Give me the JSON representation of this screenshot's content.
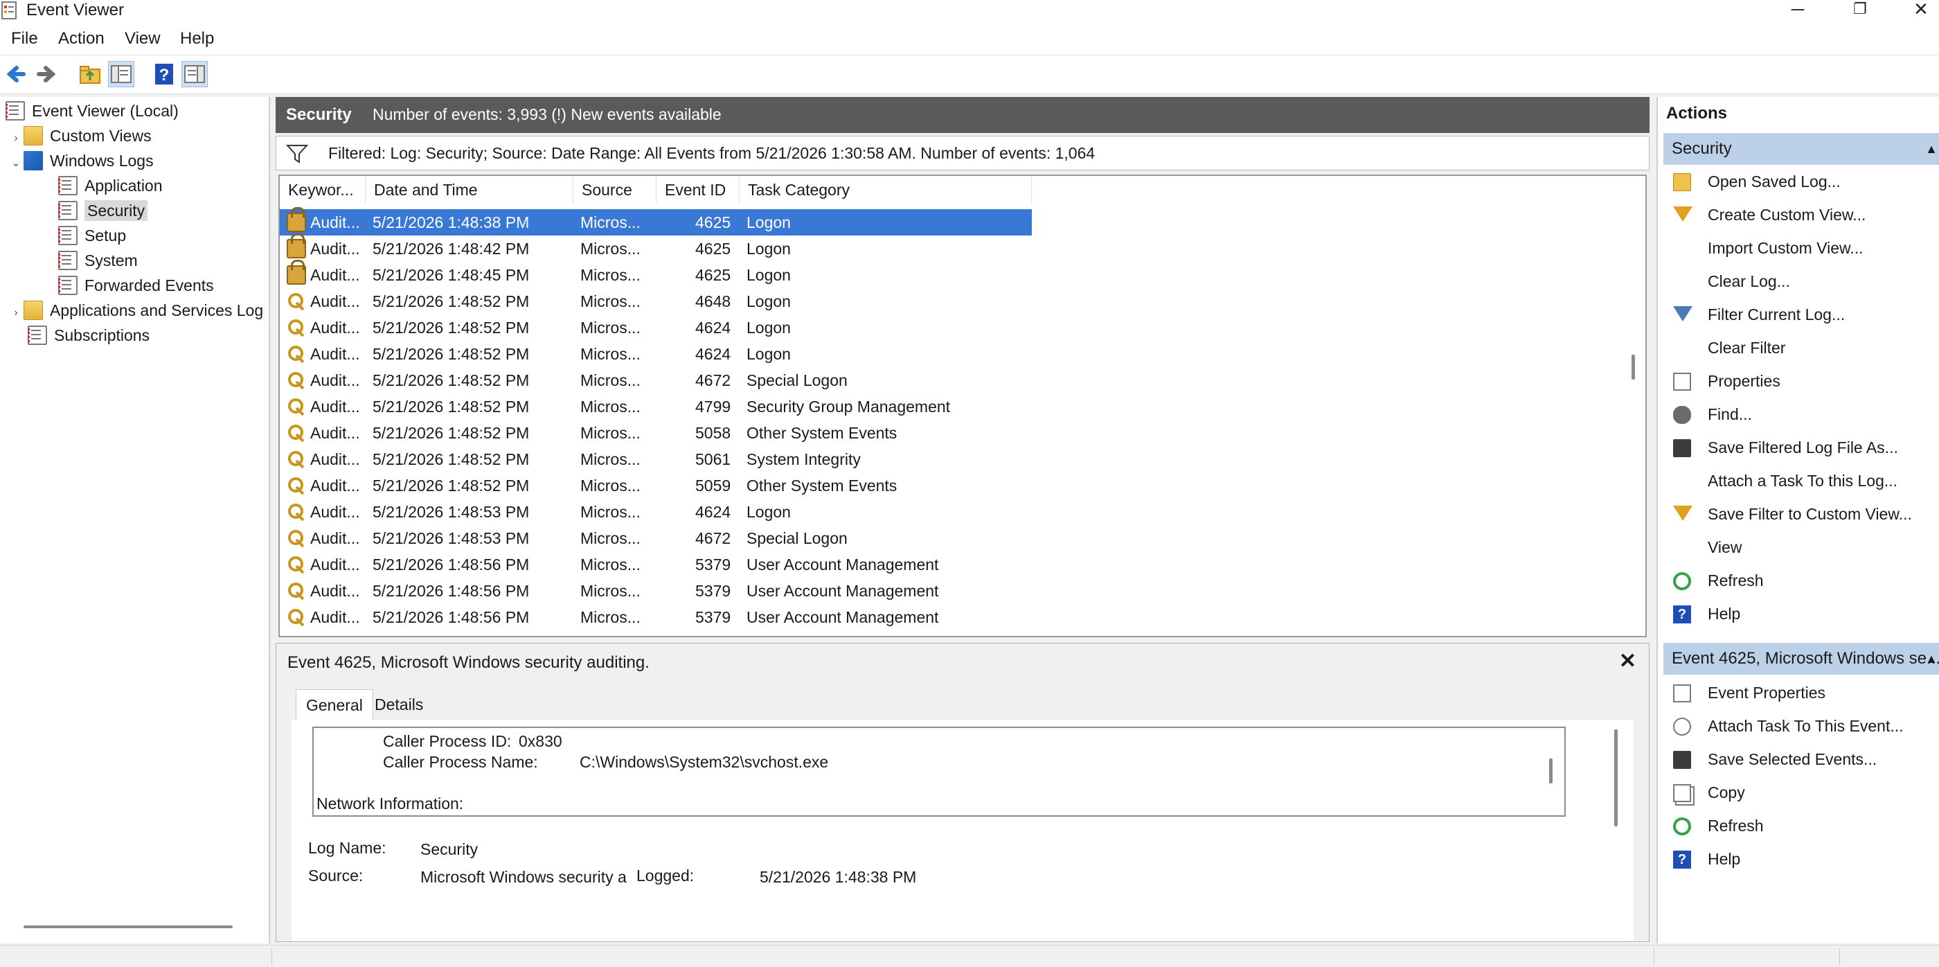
{
  "window": {
    "title": "Event Viewer",
    "minimize": "─",
    "restore": "❐",
    "close": "✕"
  },
  "menu": [
    "File",
    "Action",
    "View",
    "Help"
  ],
  "tree": {
    "items": [
      {
        "label": "Event Viewer (Local)",
        "icon": "event-viewer-icon",
        "expander": ""
      },
      {
        "label": "Custom Views",
        "icon": "folder-icon",
        "expander": "›"
      },
      {
        "label": "Windows Logs",
        "icon": "windows-logs-icon",
        "expander": "⌄"
      },
      {
        "label": "Application",
        "icon": "log-icon",
        "expander": ""
      },
      {
        "label": "Security",
        "icon": "log-icon",
        "expander": ""
      },
      {
        "label": "Setup",
        "icon": "log-icon",
        "expander": ""
      },
      {
        "label": "System",
        "icon": "log-icon",
        "expander": ""
      },
      {
        "label": "Forwarded Events",
        "icon": "log-icon",
        "expander": ""
      },
      {
        "label": "Applications and Services Log",
        "icon": "folder-icon",
        "expander": "›"
      },
      {
        "label": "Subscriptions",
        "icon": "subscriptions-icon",
        "expander": ""
      }
    ],
    "selected": "Security"
  },
  "log_header": {
    "name": "Security",
    "info": "Number of events: 3,993 (!) New events available"
  },
  "filter": {
    "text": "Filtered: Log: Security; Source: Date Range: All Events from 5/21/2026 1:30:58 AM. Number of events: 1,064"
  },
  "grid": {
    "columns": [
      "Keywor...",
      "Date and Time",
      "Source",
      "Event ID",
      "Task Category"
    ],
    "sort_indicator": "^",
    "rows": [
      {
        "icon": "lock",
        "keywords": "Audit...",
        "datetime": "5/21/2026 1:48:38 PM",
        "source": "Micros...",
        "event_id": "4625",
        "task": "Logon"
      },
      {
        "icon": "lock",
        "keywords": "Audit...",
        "datetime": "5/21/2026 1:48:42 PM",
        "source": "Micros...",
        "event_id": "4625",
        "task": "Logon"
      },
      {
        "icon": "lock",
        "keywords": "Audit...",
        "datetime": "5/21/2026 1:48:45 PM",
        "source": "Micros...",
        "event_id": "4625",
        "task": "Logon"
      },
      {
        "icon": "key",
        "keywords": "Audit...",
        "datetime": "5/21/2026 1:48:52 PM",
        "source": "Micros...",
        "event_id": "4648",
        "task": "Logon"
      },
      {
        "icon": "key",
        "keywords": "Audit...",
        "datetime": "5/21/2026 1:48:52 PM",
        "source": "Micros...",
        "event_id": "4624",
        "task": "Logon"
      },
      {
        "icon": "key",
        "keywords": "Audit...",
        "datetime": "5/21/2026 1:48:52 PM",
        "source": "Micros...",
        "event_id": "4624",
        "task": "Logon"
      },
      {
        "icon": "key",
        "keywords": "Audit...",
        "datetime": "5/21/2026 1:48:52 PM",
        "source": "Micros...",
        "event_id": "4672",
        "task": "Special Logon"
      },
      {
        "icon": "key",
        "keywords": "Audit...",
        "datetime": "5/21/2026 1:48:52 PM",
        "source": "Micros...",
        "event_id": "4799",
        "task": "Security Group Management"
      },
      {
        "icon": "key",
        "keywords": "Audit...",
        "datetime": "5/21/2026 1:48:52 PM",
        "source": "Micros...",
        "event_id": "5058",
        "task": "Other System Events"
      },
      {
        "icon": "key",
        "keywords": "Audit...",
        "datetime": "5/21/2026 1:48:52 PM",
        "source": "Micros...",
        "event_id": "5061",
        "task": "System Integrity"
      },
      {
        "icon": "key",
        "keywords": "Audit...",
        "datetime": "5/21/2026 1:48:52 PM",
        "source": "Micros...",
        "event_id": "5059",
        "task": "Other System Events"
      },
      {
        "icon": "key",
        "keywords": "Audit...",
        "datetime": "5/21/2026 1:48:53 PM",
        "source": "Micros...",
        "event_id": "4624",
        "task": "Logon"
      },
      {
        "icon": "key",
        "keywords": "Audit...",
        "datetime": "5/21/2026 1:48:53 PM",
        "source": "Micros...",
        "event_id": "4672",
        "task": "Special Logon"
      },
      {
        "icon": "key",
        "keywords": "Audit...",
        "datetime": "5/21/2026 1:48:56 PM",
        "source": "Micros...",
        "event_id": "5379",
        "task": "User Account Management"
      },
      {
        "icon": "key",
        "keywords": "Audit...",
        "datetime": "5/21/2026 1:48:56 PM",
        "source": "Micros...",
        "event_id": "5379",
        "task": "User Account Management"
      },
      {
        "icon": "key",
        "keywords": "Audit...",
        "datetime": "5/21/2026 1:48:56 PM",
        "source": "Micros...",
        "event_id": "5379",
        "task": "User Account Management"
      }
    ]
  },
  "detail": {
    "title": "Event 4625, Microsoft Windows security auditing.",
    "close": "✕",
    "tabs": [
      "General",
      "Details"
    ],
    "description": {
      "caller_pid_label": "Caller Process ID:",
      "caller_pid_value": "0x830",
      "caller_name_label": "Caller Process Name:",
      "caller_name_value": "C:\\Windows\\System32\\svchost.exe",
      "network_label": "Network Information:"
    },
    "log_name_label": "Log Name:",
    "log_name_value": "Security",
    "source_label": "Source:",
    "source_value": "Microsoft Windows security a",
    "logged_label": "Logged:",
    "logged_value": "5/21/2026 1:48:38 PM"
  },
  "actions": {
    "title": "Actions",
    "section1": "Security",
    "section1_items": [
      {
        "label": "Open Saved Log...",
        "icon": "open-folder-icon"
      },
      {
        "label": "Create Custom View...",
        "icon": "filter-funnel-icon"
      },
      {
        "label": "Import Custom View...",
        "icon": ""
      },
      {
        "label": "Clear Log...",
        "icon": ""
      },
      {
        "label": "Filter Current Log...",
        "icon": "filter-funnel-icon"
      },
      {
        "label": "Clear Filter",
        "icon": ""
      },
      {
        "label": "Properties",
        "icon": "properties-icon"
      },
      {
        "label": "Find...",
        "icon": "binoculars-icon"
      },
      {
        "label": "Save Filtered Log File As...",
        "icon": "save-icon"
      },
      {
        "label": "Attach a Task To this Log...",
        "icon": ""
      },
      {
        "label": "Save Filter to Custom View...",
        "icon": "filter-funnel-icon"
      },
      {
        "label": "View",
        "icon": ""
      },
      {
        "label": "Refresh",
        "icon": "refresh-icon"
      },
      {
        "label": "Help",
        "icon": "help-icon"
      }
    ],
    "section2": "Event 4625, Microsoft Windows se...",
    "section2_items": [
      {
        "label": "Event Properties",
        "icon": "properties-icon"
      },
      {
        "label": "Attach Task To This Event...",
        "icon": "task-icon"
      },
      {
        "label": "Save Selected Events...",
        "icon": "save-icon"
      },
      {
        "label": "Copy",
        "icon": "copy-icon"
      },
      {
        "label": "Refresh",
        "icon": "refresh-icon"
      },
      {
        "label": "Help",
        "icon": "help-icon"
      }
    ]
  },
  "colors": {
    "selection": "#3a78d6",
    "header": "#5a5a5a",
    "section": "#bcd0e8"
  }
}
